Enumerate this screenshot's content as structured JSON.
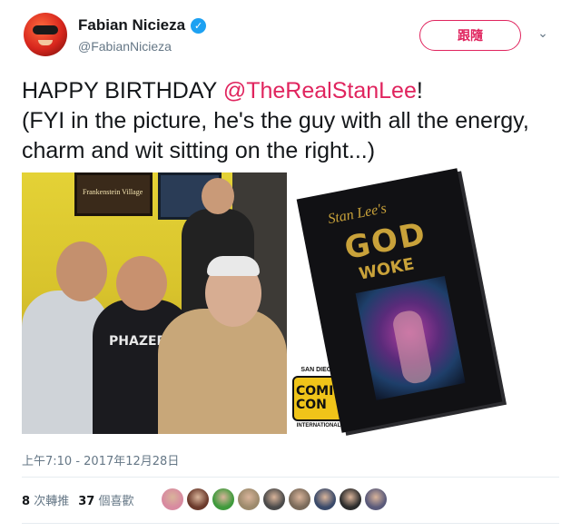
{
  "author": {
    "display_name": "Fabian Nicieza",
    "handle": "@FabianNicieza",
    "verified_glyph": "✓"
  },
  "follow_button_label": "跟隨",
  "menu_icon_glyph": "⌄",
  "tweet": {
    "line1_prefix": "HAPPY BIRTHDAY ",
    "mention": "@TheRealStanLee",
    "line1_suffix": "!",
    "line2": "(FYI in the picture, he's the guy with all the energy, charm and wit sitting on the right...)"
  },
  "media": {
    "photo_poster_text": "Frankenstein Village",
    "photo_shirt_text": "PHAZER",
    "comic_con": {
      "top": "SAN DIEGO",
      "mid_line1": "COMIC",
      "mid_line2": "CON",
      "bottom": "INTERNATIONAL"
    },
    "book": {
      "signature": "Stan Lee's",
      "title_line1": "GOD",
      "title_line2": "WOKE"
    }
  },
  "timestamp": "上午7:10 - 2017年12月28日",
  "stats": {
    "retweets_count": "8",
    "retweets_label": "次轉推",
    "likes_count": "37",
    "likes_label": "個喜歡"
  },
  "liker_avatar_colors": [
    "#d88aa0",
    "#6b3a2c",
    "#3f9a3c",
    "#9c8a6c",
    "#4a4a4a",
    "#7a6a5a",
    "#3a4a6a",
    "#2c2c2c",
    "#5a5a7a"
  ],
  "colors": {
    "accent": "#e0245e",
    "verified": "#1da1f2",
    "secondary_text": "#657786"
  }
}
